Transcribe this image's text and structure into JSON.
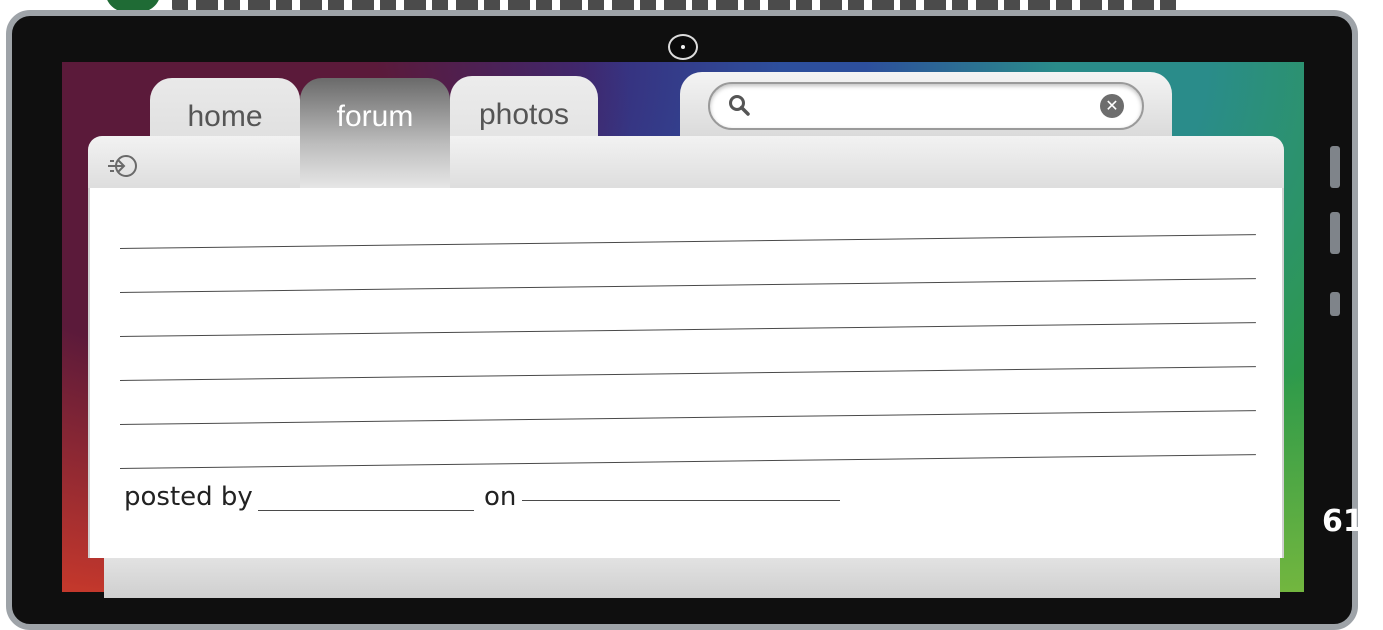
{
  "tabs": [
    {
      "label": "home"
    },
    {
      "label": "forum"
    },
    {
      "label": "photos"
    }
  ],
  "active_tab": "forum",
  "search": {
    "value": "",
    "placeholder": ""
  },
  "post_form": {
    "line_count": 6,
    "posted_by_label": "posted by",
    "on_label": "on"
  },
  "page_number": "61",
  "colors": {
    "frame": "#0f0f0f",
    "bezel": "#9ea3a8",
    "tab_active": "#6a6a6a",
    "tab_inactive": "#e6e6e6"
  }
}
